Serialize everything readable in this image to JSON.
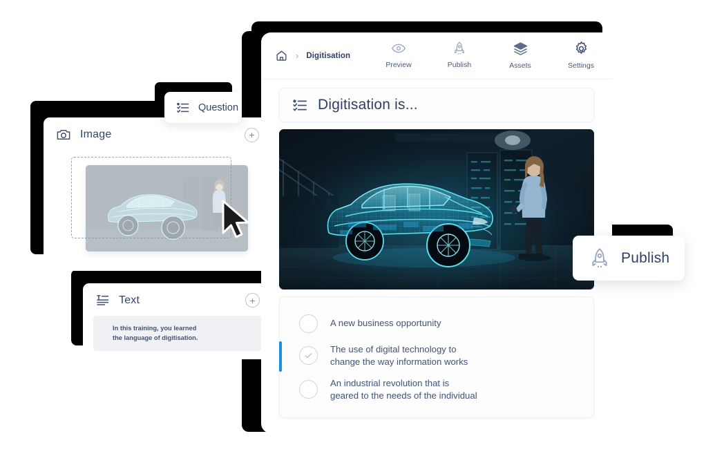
{
  "editor": {
    "breadcrumb": {
      "home_icon": "home-icon",
      "separator": "›",
      "current": "Digitisation"
    },
    "nav_actions": [
      {
        "label": "Preview",
        "icon": "eye-icon"
      },
      {
        "label": "Publish",
        "icon": "rocket-icon"
      },
      {
        "label": "Assets",
        "icon": "layers-icon"
      },
      {
        "label": "Settings",
        "icon": "gear-icon"
      }
    ],
    "question": {
      "icon": "question-list-icon",
      "title": "Digitisation is...",
      "hero_image_alt": "wireframe-car-hologram",
      "options": [
        {
          "text": "A new business opportunity",
          "selected": false,
          "checked": false
        },
        {
          "text": "The use of digital technology to\nchange the way information works",
          "selected": true,
          "checked": true
        },
        {
          "text": "An industrial revolution that is\ngeared to the needs of the individual",
          "selected": false,
          "checked": false
        }
      ]
    }
  },
  "question_tab": {
    "label": "Question",
    "icon": "question-list-icon"
  },
  "image_card": {
    "title": "Image",
    "icon": "camera-icon",
    "add_label": "+",
    "dragging_image_alt": "wireframe-car-hologram-thumbnail",
    "cursor": "arrow-cursor"
  },
  "text_card": {
    "title": "Text",
    "icon": "text-align-icon",
    "add_label": "+",
    "body": "In this training, you learned\nthe language of digitisation."
  },
  "publish_float": {
    "label": "Publish",
    "icon": "rocket-icon"
  },
  "colors": {
    "accent_blue": "#1a8fe3",
    "text_navy": "#33456a",
    "muted": "#8b97ad",
    "panel": "#ffffff",
    "hero_dark": "#0d1a24",
    "hologram_cyan": "#2fd8f5"
  }
}
